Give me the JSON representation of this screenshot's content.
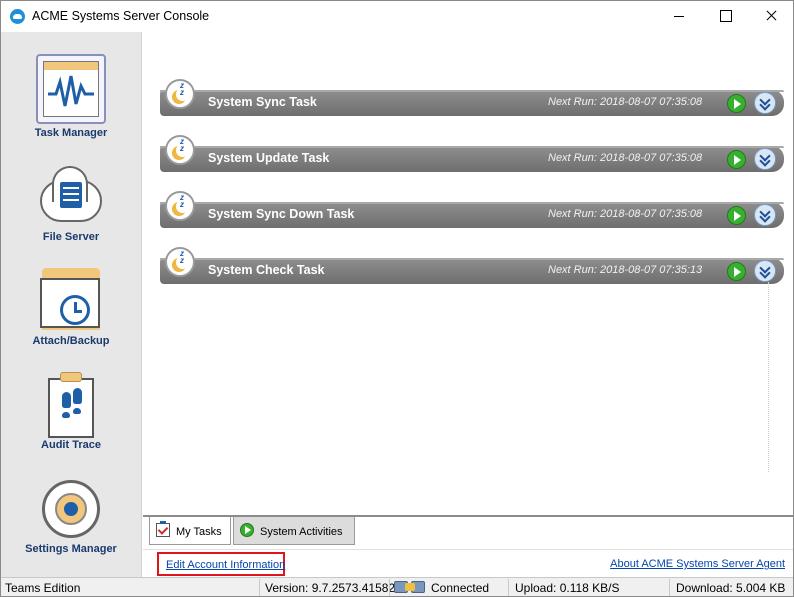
{
  "window": {
    "title": "ACME Systems Server Console"
  },
  "sidebar": {
    "items": [
      {
        "label": "Task Manager",
        "icon": "activity-monitor-icon",
        "selected": true
      },
      {
        "label": "File Server",
        "icon": "cloud-server-icon"
      },
      {
        "label": "Attach/Backup",
        "icon": "folder-clock-icon"
      },
      {
        "label": "Audit Trace",
        "icon": "clipboard-footprints-icon"
      },
      {
        "label": "Settings Manager",
        "icon": "gear-icon"
      }
    ]
  },
  "tasks": [
    {
      "name": "System Sync Task",
      "next_run": "Next Run: 2018-08-07 07:35:08",
      "status_icon": "sleeping-moon-icon"
    },
    {
      "name": "System Update Task",
      "next_run": "Next Run: 2018-08-07 07:35:08",
      "status_icon": "sleeping-moon-icon"
    },
    {
      "name": "System Sync Down Task",
      "next_run": "Next Run: 2018-08-07 07:35:08",
      "status_icon": "sleeping-moon-icon"
    },
    {
      "name": "System Check Task",
      "next_run": "Next Run: 2018-08-07 07:35:13",
      "status_icon": "sleeping-moon-icon"
    }
  ],
  "tabs": [
    {
      "label": "My Tasks",
      "icon": "checklist-icon",
      "active": true
    },
    {
      "label": "System Activities",
      "icon": "green-play-icon",
      "active": false
    }
  ],
  "links": {
    "edit_account": "Edit Account Information",
    "about": "About ACME Systems Server Agent"
  },
  "statusbar": {
    "edition": "Teams Edition",
    "version": "Version: 9.7.2573.41582",
    "connection": "Connected",
    "upload": "Upload: 0.118 KB/S",
    "download": "Download: 5.004 KB"
  },
  "colors": {
    "accent_blue": "#1e5fa8",
    "task_bar": "#7f7f7f",
    "highlight_box": "#e0141c",
    "play_green": "#36b02e"
  }
}
